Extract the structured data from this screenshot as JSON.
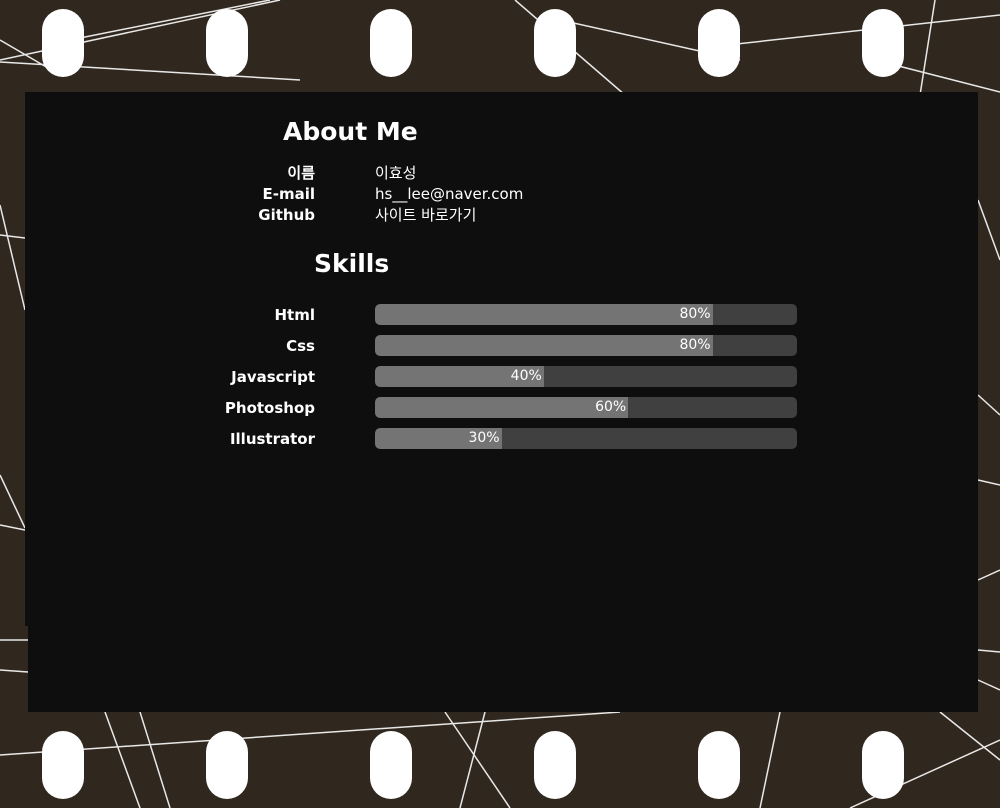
{
  "about": {
    "title": "About Me",
    "rows": [
      {
        "label": "이름",
        "value": "이효성"
      },
      {
        "label": "E-mail",
        "value": "hs__lee@naver.com"
      },
      {
        "label": "Github",
        "value": "사이트 바로가기"
      }
    ]
  },
  "skills": {
    "title": "Skills",
    "items": [
      {
        "name": "Html",
        "percent": 80,
        "percent_label": "80%"
      },
      {
        "name": "Css",
        "percent": 80,
        "percent_label": "80%"
      },
      {
        "name": "Javascript",
        "percent": 40,
        "percent_label": "40%"
      },
      {
        "name": "Photoshop",
        "percent": 60,
        "percent_label": "60%"
      },
      {
        "name": "Illustrator",
        "percent": 30,
        "percent_label": "30%"
      }
    ]
  },
  "colors": {
    "background": "#30281e",
    "panel": "#0e0e0e",
    "bar_track": "#404040",
    "bar_fill": "#747474",
    "text": "#ffffff",
    "film_hole": "#ffffff"
  }
}
